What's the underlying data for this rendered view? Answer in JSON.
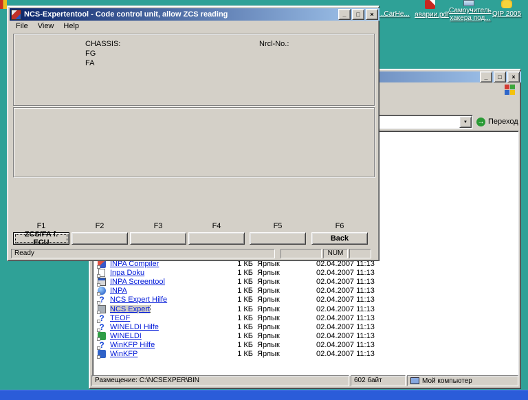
{
  "desktop": {
    "bg_color": "#2fa197",
    "icons": [
      {
        "label": "...CarHe...",
        "icon": "file-icon"
      },
      {
        "label": "аварии.pdf",
        "icon": "pdf-icon"
      },
      {
        "label": "Самоучитель хакера под...",
        "icon": "book-icon"
      },
      {
        "label": "QIP 2005",
        "icon": "qip-icon"
      }
    ]
  },
  "window_controls": {
    "minimize": "_",
    "maximize": "□",
    "close": "×"
  },
  "ncs": {
    "title": "NCS-Expertentool - Code control unit, allow ZCS reading",
    "menu": [
      "File",
      "View",
      "Help"
    ],
    "panel": {
      "chassis": "CHASSIS:",
      "fg": "FG",
      "fa": "FA",
      "nrcl": "Nrcl-No.:"
    },
    "fkey_labels": [
      "F1",
      "F2",
      "F3",
      "F4",
      "F5",
      "F6"
    ],
    "fkey_buttons": [
      "ZCS/FA f. ECU",
      "",
      "",
      "",
      "",
      "Back"
    ],
    "status": {
      "message": "Ready",
      "num": "NUM"
    }
  },
  "explorer": {
    "go_label": "Переход",
    "address_value": "",
    "files": [
      {
        "name": "INPA Compiler",
        "size": "1 КБ",
        "type": "Ярлык",
        "modified": "02.04.2007 11:13",
        "icon": "app-red"
      },
      {
        "name": "Inpa Doku",
        "size": "1 КБ",
        "type": "Ярлык",
        "modified": "02.04.2007 11:13",
        "icon": "doc"
      },
      {
        "name": "INPA Screentool",
        "size": "1 КБ",
        "type": "Ярлык",
        "modified": "02.04.2007 11:13",
        "icon": "window"
      },
      {
        "name": "INPA",
        "size": "1 КБ",
        "type": "Ярлык",
        "modified": "02.04.2007 11:13",
        "icon": "globe"
      },
      {
        "name": "NCS Expert Hilfe",
        "size": "1 КБ",
        "type": "Ярлык",
        "modified": "02.04.2007 11:13",
        "icon": "help"
      },
      {
        "name": "NCS Expert",
        "size": "1 КБ",
        "type": "Ярлык",
        "modified": "02.04.2007 11:13",
        "icon": "app-gray"
      },
      {
        "name": "TEOF",
        "size": "1 КБ",
        "type": "Ярлык",
        "modified": "02.04.2007 11:13",
        "icon": "help"
      },
      {
        "name": "WINELDI Hilfe",
        "size": "1 КБ",
        "type": "Ярлык",
        "modified": "02.04.2007 11:13",
        "icon": "help"
      },
      {
        "name": "WINELDI",
        "size": "1 КБ",
        "type": "Ярлык",
        "modified": "02.04.2007 11:13",
        "icon": "app-green"
      },
      {
        "name": "WinKFP Hilfe",
        "size": "1 КБ",
        "type": "Ярлык",
        "modified": "02.04.2007 11:13",
        "icon": "help"
      },
      {
        "name": "WinKFP",
        "size": "1 КБ",
        "type": "Ярлык",
        "modified": "02.04.2007 11:13",
        "icon": "app-blue"
      }
    ],
    "status": {
      "location": "Размещение: C:\\NCSEXPER\\BIN",
      "size": "602 байт",
      "zone": "Мой компьютер"
    }
  }
}
